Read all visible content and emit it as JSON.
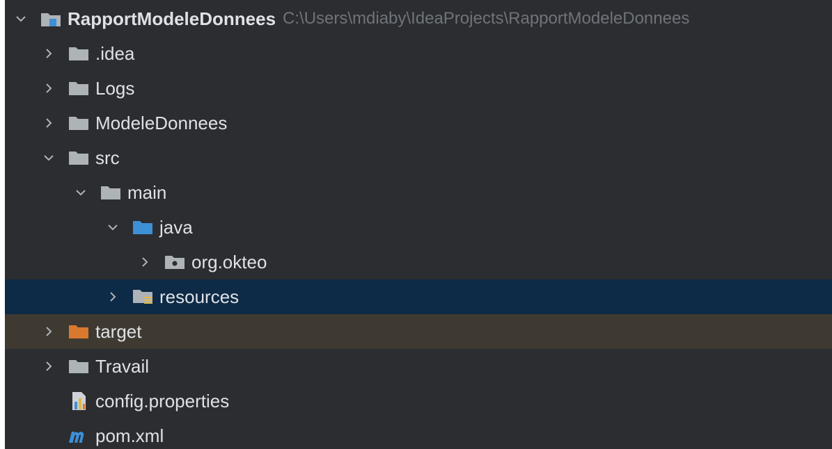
{
  "project_tree": {
    "root": {
      "label": "RapportModeleDonnees",
      "path": "C:\\Users\\mdiaby\\IdeaProjects\\RapportModeleDonnees"
    },
    "items": [
      {
        "label": ".idea"
      },
      {
        "label": "Logs"
      },
      {
        "label": "ModeleDonnees"
      },
      {
        "label": "src"
      },
      {
        "label": "main"
      },
      {
        "label": "java"
      },
      {
        "label": "org.okteo"
      },
      {
        "label": "resources"
      },
      {
        "label": "target"
      },
      {
        "label": "Travail"
      },
      {
        "label": "config.properties"
      },
      {
        "label": "pom.xml"
      }
    ]
  },
  "colors": {
    "background": "#2b2d30",
    "selected_row": "#0d2a46",
    "highlighted_row": "#3e3a32",
    "folder": "#aeb3b8",
    "source_folder": "#3d8fd6",
    "excluded_folder": "#d9782f",
    "text": "#dfe1e5",
    "path_text": "#6f737a"
  }
}
